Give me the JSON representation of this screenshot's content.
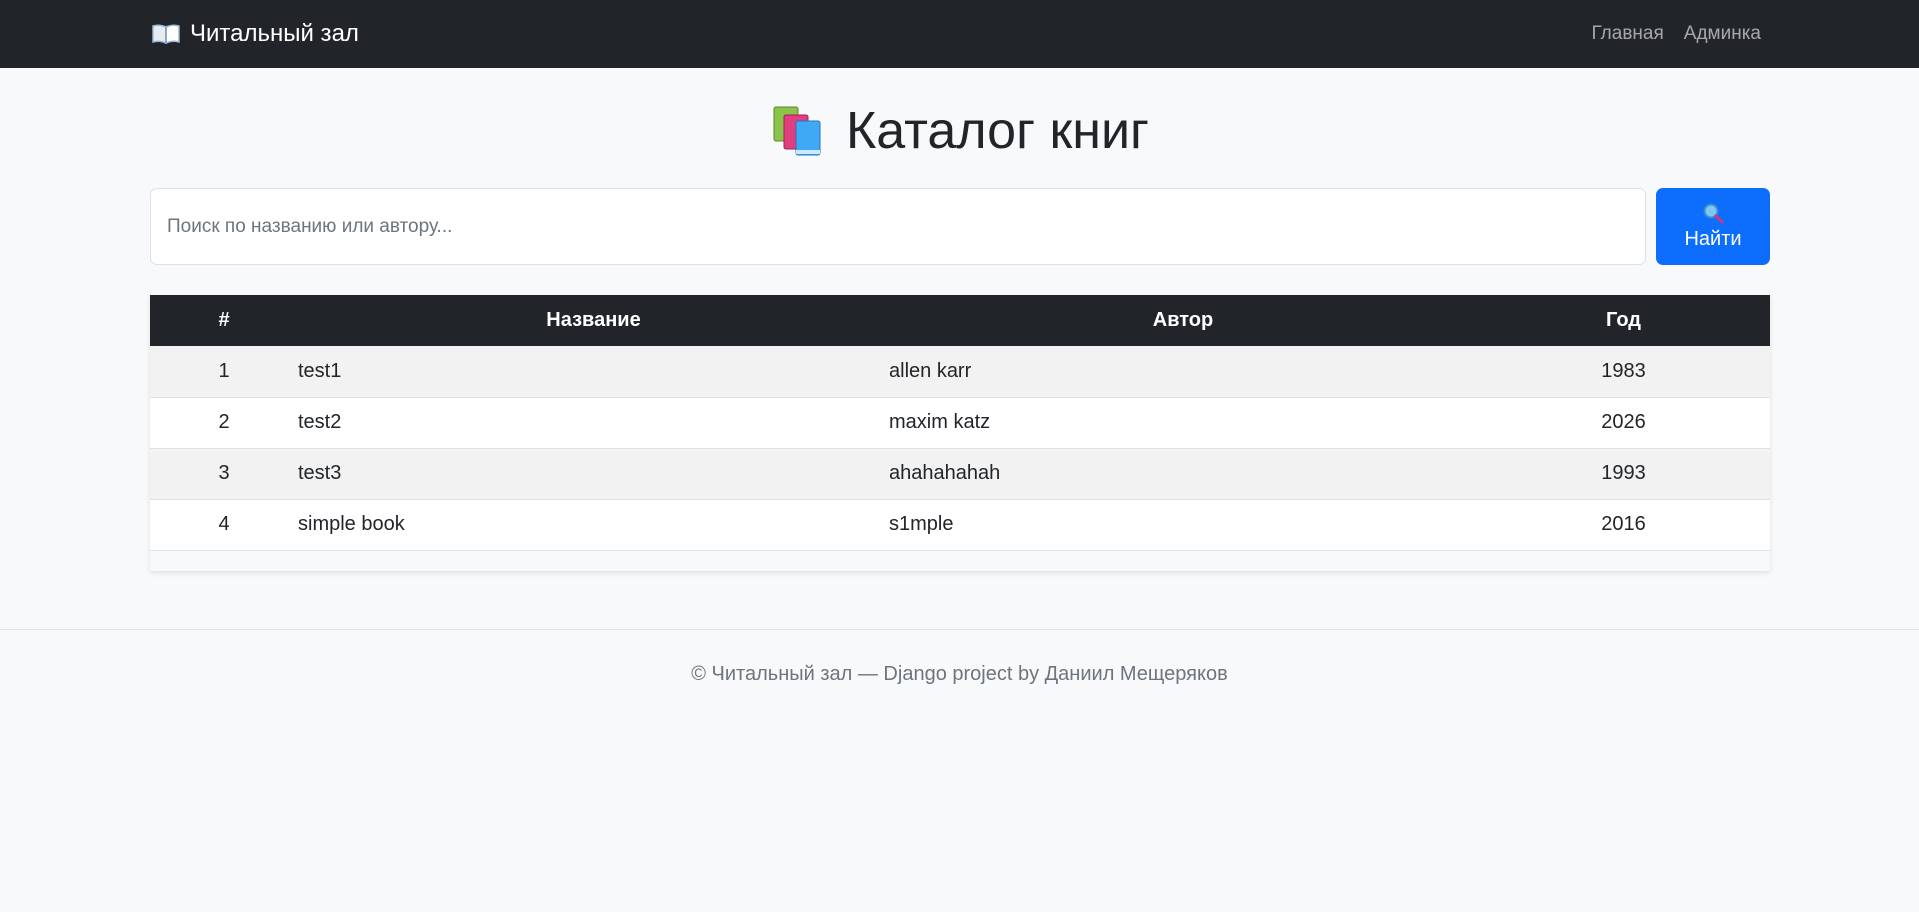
{
  "navbar": {
    "brand_label": "Читальный зал",
    "links": [
      {
        "label": "Главная"
      },
      {
        "label": "Админка"
      }
    ]
  },
  "page": {
    "title": "Каталог книг"
  },
  "search": {
    "placeholder": "Поиск по названию или автору...",
    "value": "",
    "button_label": "Найти"
  },
  "table": {
    "columns": [
      "#",
      "Название",
      "Автор",
      "Год"
    ],
    "rows": [
      {
        "num": "1",
        "title": "test1",
        "author": "allen karr",
        "year": "1983"
      },
      {
        "num": "2",
        "title": "test2",
        "author": "maxim katz",
        "year": "2026"
      },
      {
        "num": "3",
        "title": "test3",
        "author": "ahahahahah",
        "year": "1993"
      },
      {
        "num": "4",
        "title": "simple book",
        "author": "s1mple",
        "year": "2016"
      }
    ]
  },
  "footer": {
    "text": "© Читальный зал — Django project by Даниил Мещеряков"
  },
  "colors": {
    "navbar_bg": "#212529",
    "primary": "#0d6efd",
    "page_bg": "#f8f9fa"
  },
  "icons": {
    "brand": "open-book-icon",
    "title": "books-icon",
    "search": "magnifier-icon"
  }
}
